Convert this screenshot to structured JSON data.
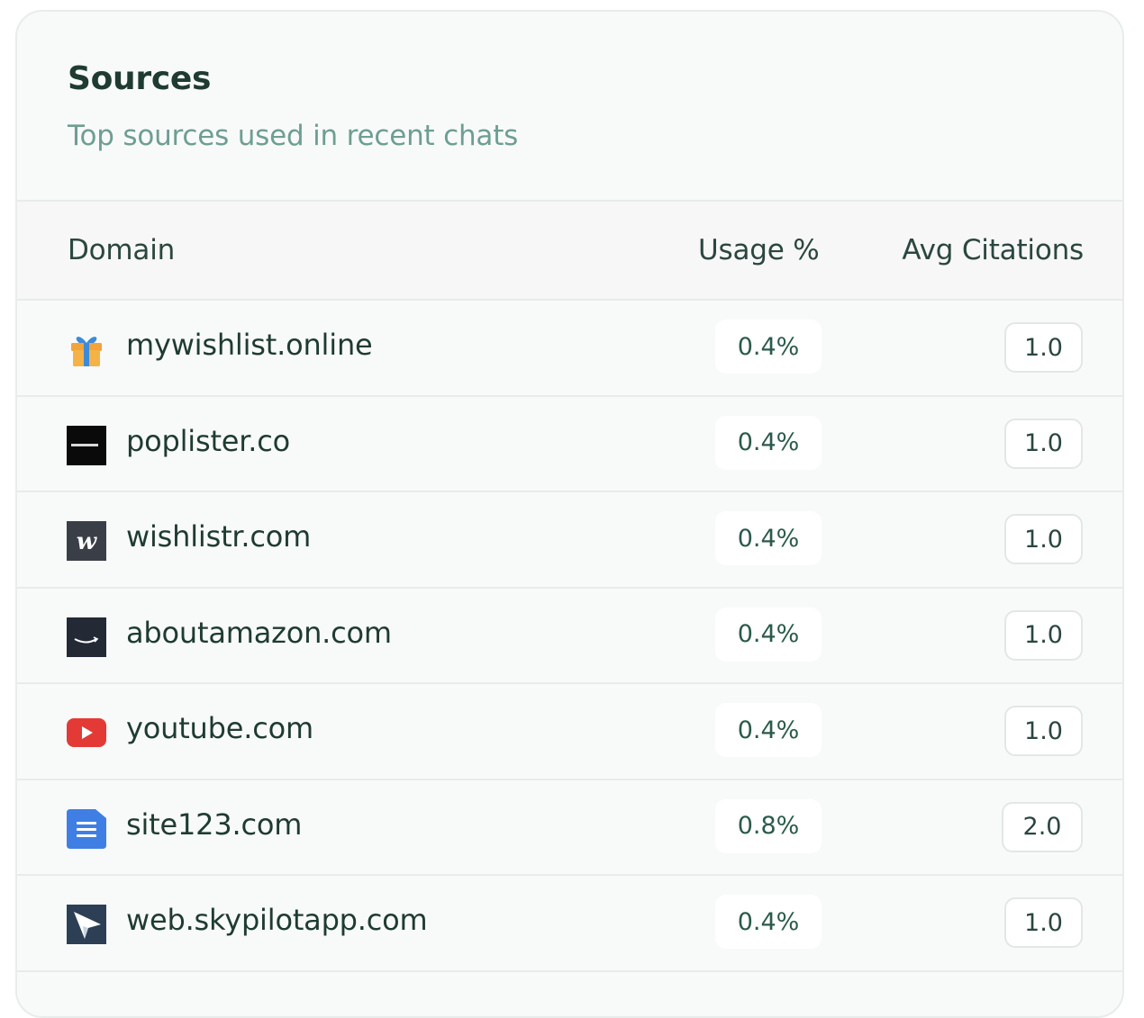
{
  "card": {
    "title": "Sources",
    "subtitle": "Top sources used in recent chats"
  },
  "table": {
    "headers": {
      "domain": "Domain",
      "usage": "Usage %",
      "avg_citations": "Avg Citations"
    },
    "rows": [
      {
        "icon": "gift-icon",
        "domain": "mywishlist.online",
        "usage": "0.4%",
        "avg_citations": "1.0"
      },
      {
        "icon": "poplister-logo-icon",
        "domain": "poplister.co",
        "usage": "0.4%",
        "avg_citations": "1.0"
      },
      {
        "icon": "wishlistr-w-icon",
        "domain": "wishlistr.com",
        "usage": "0.4%",
        "avg_citations": "1.0"
      },
      {
        "icon": "amazon-smile-icon",
        "domain": "aboutamazon.com",
        "usage": "0.4%",
        "avg_citations": "1.0"
      },
      {
        "icon": "youtube-play-icon",
        "domain": "youtube.com",
        "usage": "0.4%",
        "avg_citations": "1.0"
      },
      {
        "icon": "document-icon",
        "domain": "site123.com",
        "usage": "0.8%",
        "avg_citations": "2.0"
      },
      {
        "icon": "paper-plane-icon",
        "domain": "web.skypilotapp.com",
        "usage": "0.4%",
        "avg_citations": "1.0"
      }
    ]
  },
  "colors": {
    "title": "#1f3b32",
    "subtitle": "#6e9e92",
    "usage_text": "#2b5a4d",
    "youtube_red": "#e43a36",
    "site123_blue": "#3f7fe3"
  }
}
